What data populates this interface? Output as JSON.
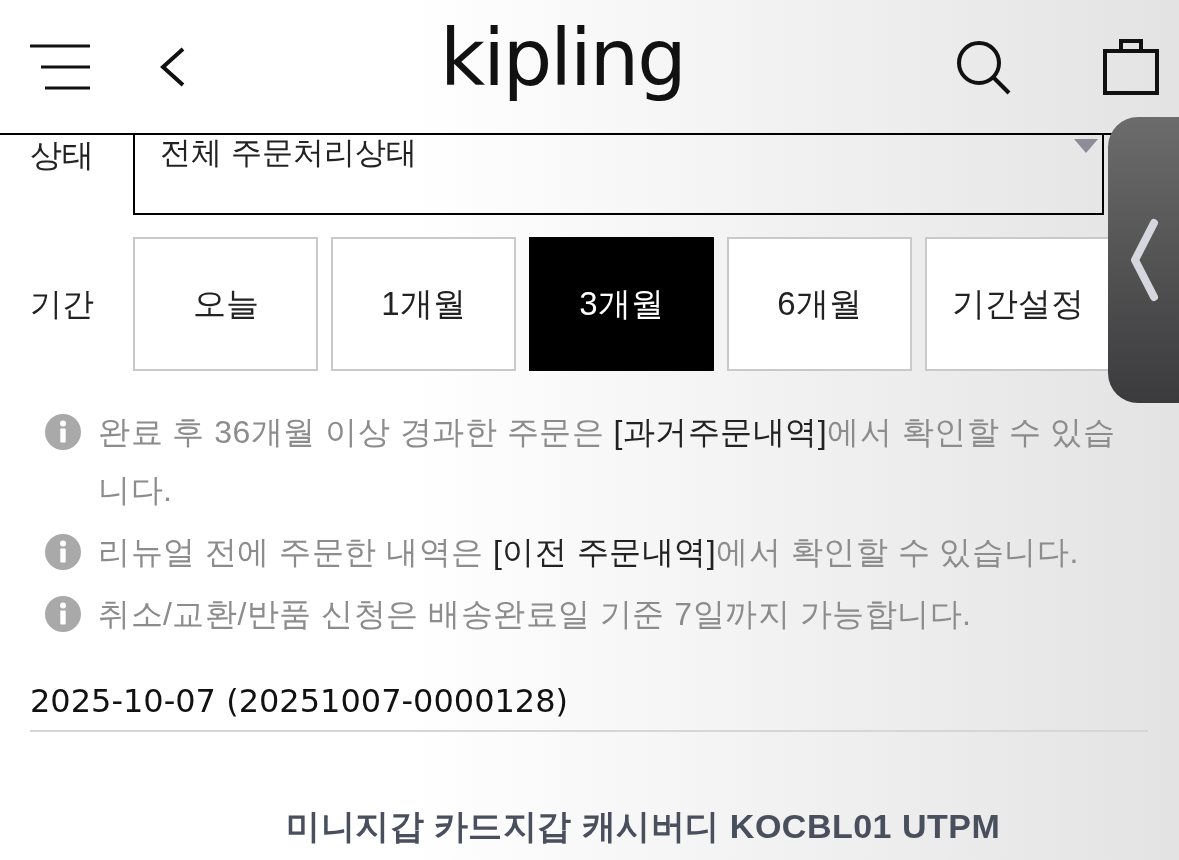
{
  "header": {
    "logo": "kipling"
  },
  "status_filter": {
    "label": "상태",
    "value": "전체 주문처리상태"
  },
  "period_filter": {
    "label": "기간",
    "options": [
      {
        "label": "오늘",
        "selected": false
      },
      {
        "label": "1개월",
        "selected": false
      },
      {
        "label": "3개월",
        "selected": true
      },
      {
        "label": "6개월",
        "selected": false
      },
      {
        "label": "기간설정",
        "selected": false
      }
    ]
  },
  "notes": [
    {
      "text_before": "완료 후 36개월 이상 경과한 주문은 ",
      "link": "[과거주문내역]",
      "text_after": "에서 확인할 수 있습니다."
    },
    {
      "text_before": "리뉴얼 전에 주문한 내역은 ",
      "link": "[이전 주문내역]",
      "text_after": "에서 확인할 수 있습니다."
    },
    {
      "text_before": "취소/교환/반품 신청은 배송완료일 기준 7일까지 가능합니다."
    }
  ],
  "orders": [
    {
      "heading": "2025-10-07 (20251007-0000128)",
      "items": [
        {
          "name": "미니지갑 카드지갑 캐시버디 KOCBL01 UTPM"
        }
      ]
    }
  ]
}
